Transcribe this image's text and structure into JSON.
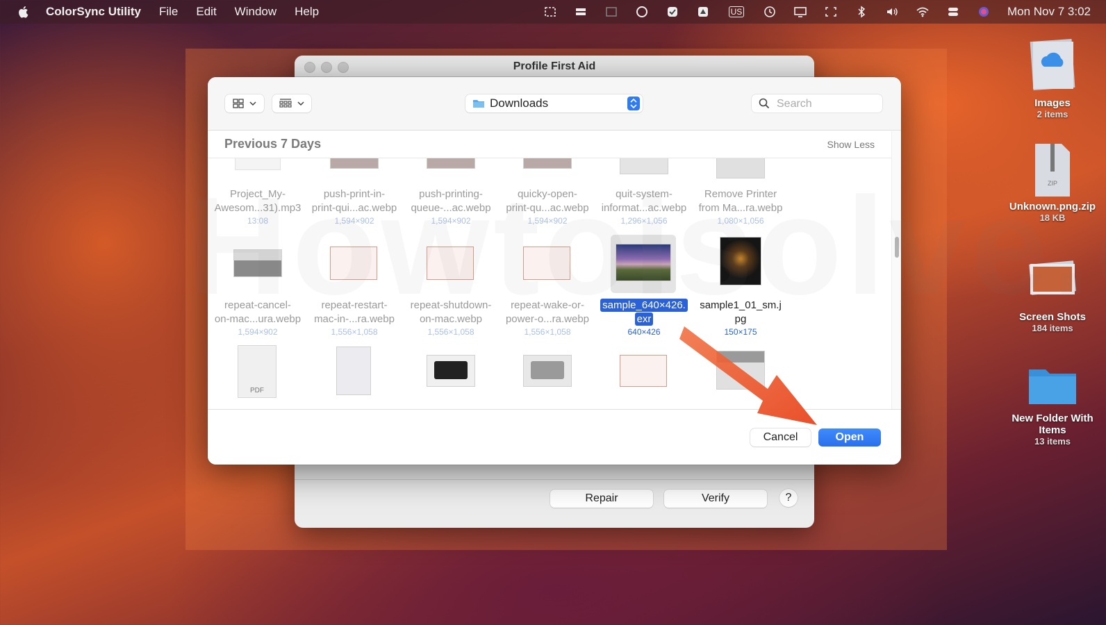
{
  "menubar": {
    "app_name": "ColorSync Utility",
    "menus": [
      "File",
      "Edit",
      "Window",
      "Help"
    ],
    "input_source": "US",
    "clock": "Mon Nov 7  3:02"
  },
  "pfa_window": {
    "title": "Profile First Aid",
    "repair_label": "Repair",
    "verify_label": "Verify",
    "help_label": "?"
  },
  "dialog": {
    "location": "Downloads",
    "search_placeholder": "Search",
    "section_title": "Previous 7 Days",
    "show_less_label": "Show Less",
    "cancel_label": "Cancel",
    "open_label": "Open",
    "watermark": "Howtoisolve.com",
    "rows": [
      [
        {
          "line1": "Project_My-",
          "line2": "Awesom...31).mp3",
          "meta": "13:08"
        },
        {
          "line1": "push-print-in-",
          "line2": "print-qui...ac.webp",
          "meta": "1,594×902"
        },
        {
          "line1": "push-printing-",
          "line2": "queue-...ac.webp",
          "meta": "1,594×902"
        },
        {
          "line1": "quicky-open-",
          "line2": "print-qu...ac.webp",
          "meta": "1,594×902"
        },
        {
          "line1": "quit-system-",
          "line2": "informat...ac.webp",
          "meta": "1,296×1,056"
        },
        {
          "line1": "Remove Printer",
          "line2": "from Ma...ra.webp",
          "meta": "1,080×1,056"
        }
      ],
      [
        {
          "line1": "repeat-cancel-",
          "line2": "on-mac...ura.webp",
          "meta": "1,594×902"
        },
        {
          "line1": "repeat-restart-",
          "line2": "mac-in-...ra.webp",
          "meta": "1,556×1,058"
        },
        {
          "line1": "repeat-shutdown-",
          "line2": "on-mac.webp",
          "meta": "1,556×1,058"
        },
        {
          "line1": "repeat-wake-or-",
          "line2": "power-o...ra.webp",
          "meta": "1,556×1,058"
        },
        {
          "line1": "sample_640×426.",
          "line2": "exr",
          "meta": "640×426"
        },
        {
          "line1": "sample1_01_sm.j",
          "line2": "pg",
          "meta": "150×175"
        }
      ]
    ],
    "pdf_label": "PDF"
  },
  "desktop": [
    {
      "name": "Images",
      "sub": "2 items"
    },
    {
      "name": "Unknown.png.zip",
      "sub": "18 KB"
    },
    {
      "name": "Screen Shots",
      "sub": "184 items"
    },
    {
      "name": "New Folder With Items",
      "sub": "13 items"
    }
  ],
  "zip_label": "ZIP"
}
